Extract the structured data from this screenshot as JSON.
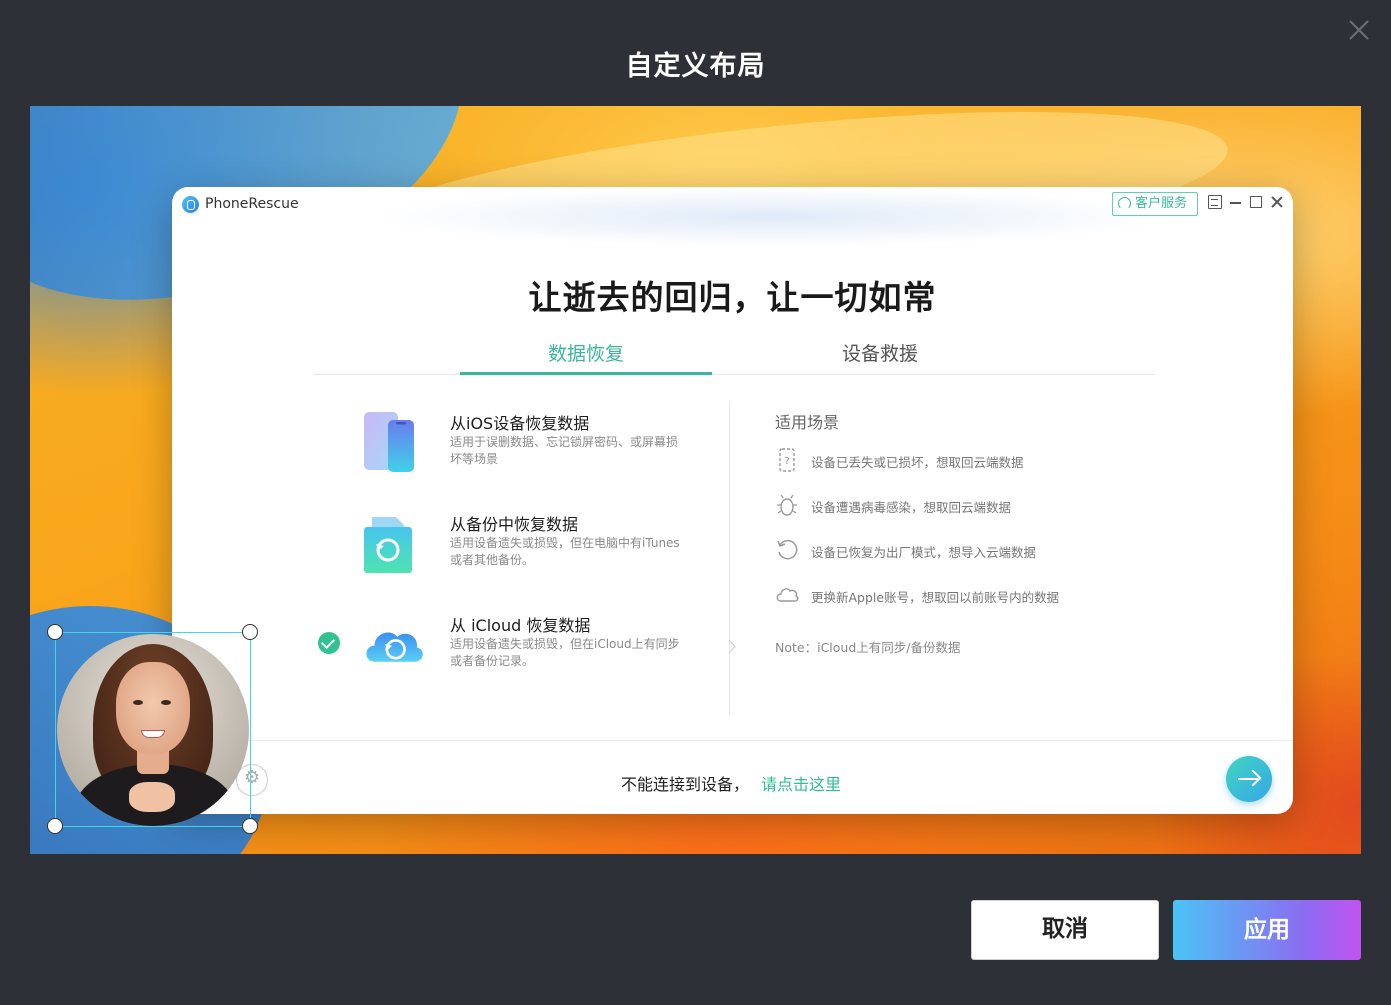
{
  "dialog": {
    "title": "自定义布局",
    "close_icon": "close-icon",
    "cancel_label": "取消",
    "apply_label": "应用"
  },
  "app": {
    "name": "PhoneRescue",
    "service_label": "客户服务",
    "hero_title": "让逝去的回归，让一切如常",
    "tabs": [
      {
        "label": "数据恢复",
        "active": true
      },
      {
        "label": "设备救援",
        "active": false
      }
    ],
    "options": [
      {
        "title": "从iOS设备恢复数据",
        "desc": "适用于误删数据、忘记锁屏密码、或屏幕损坏等场景",
        "icon": "phone-icon"
      },
      {
        "title": "从备份中恢复数据",
        "desc": "适用设备遗失或损毁，但在电脑中有iTunes或者其他备份。",
        "icon": "backup-file-icon"
      },
      {
        "title": "从 iCloud 恢复数据",
        "desc": "适用设备遗失或损毁，但在iCloud上有同步或者备份记录。",
        "icon": "icloud-icon",
        "selected": true
      }
    ],
    "scenarios": {
      "title": "适用场景",
      "items": [
        {
          "text": "设备已丢失或已损坏，想取回云端数据",
          "icon": "unknown-device-icon"
        },
        {
          "text": "设备遭遇病毒感染，想取回云端数据",
          "icon": "bug-icon"
        },
        {
          "text": "设备已恢复为出厂模式，想导入云端数据",
          "icon": "restore-icon"
        },
        {
          "text": "更换新Apple账号，想取回以前账号内的数据",
          "icon": "cloud-icon"
        }
      ],
      "note": "Note：iCloud上有同步/备份数据"
    },
    "footer": {
      "text": "不能连接到设备，",
      "link": "请点击这里"
    }
  },
  "colors": {
    "accent": "#3ab69c",
    "dialog_bg": "#2d3037",
    "apply_gradient_start": "#4bc4f6",
    "apply_gradient_end": "#c253f0",
    "camera_frame": "#3fd7e5"
  }
}
